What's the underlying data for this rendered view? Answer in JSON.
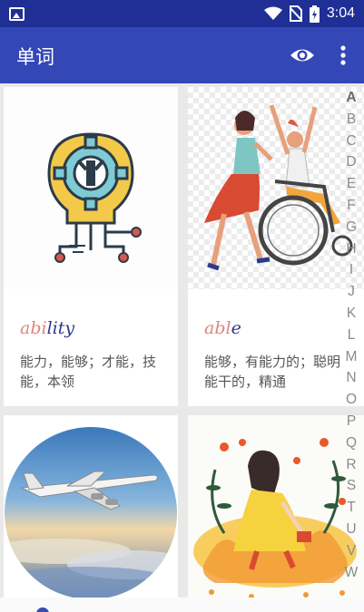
{
  "status_bar": {
    "time": "3:04",
    "icons": [
      "image-icon",
      "wifi-icon",
      "no-sim-icon",
      "battery-charging-icon"
    ]
  },
  "app_bar": {
    "title": "单词",
    "actions": [
      "eye-icon",
      "more-vert-icon"
    ],
    "color": "#3347b7"
  },
  "cards": [
    {
      "word_highlight": "abi",
      "word_rest": "lity",
      "meaning": "能力，能够；才能，技能，本领",
      "image": "lightbulb-gear-icon"
    },
    {
      "word_highlight": "abl",
      "word_rest": "e",
      "meaning": "能够，有能力的；聪明能干的，精通",
      "image": "wheelchair-illustration"
    },
    {
      "word_highlight": "",
      "word_rest": "",
      "meaning": "",
      "image": "airplane-photo"
    },
    {
      "word_highlight": "",
      "word_rest": "",
      "meaning": "",
      "image": "girl-autumn-illustration"
    }
  ],
  "colors": {
    "highlight": "#e0857e",
    "word": "#2b3a8f",
    "status_bar": "#1f2f95"
  },
  "index_letters": [
    "A",
    "B",
    "C",
    "D",
    "E",
    "F",
    "G",
    "H",
    "I",
    "J",
    "K",
    "L",
    "M",
    "N",
    "O",
    "P",
    "Q",
    "R",
    "S",
    "T",
    "U",
    "V",
    "W"
  ]
}
